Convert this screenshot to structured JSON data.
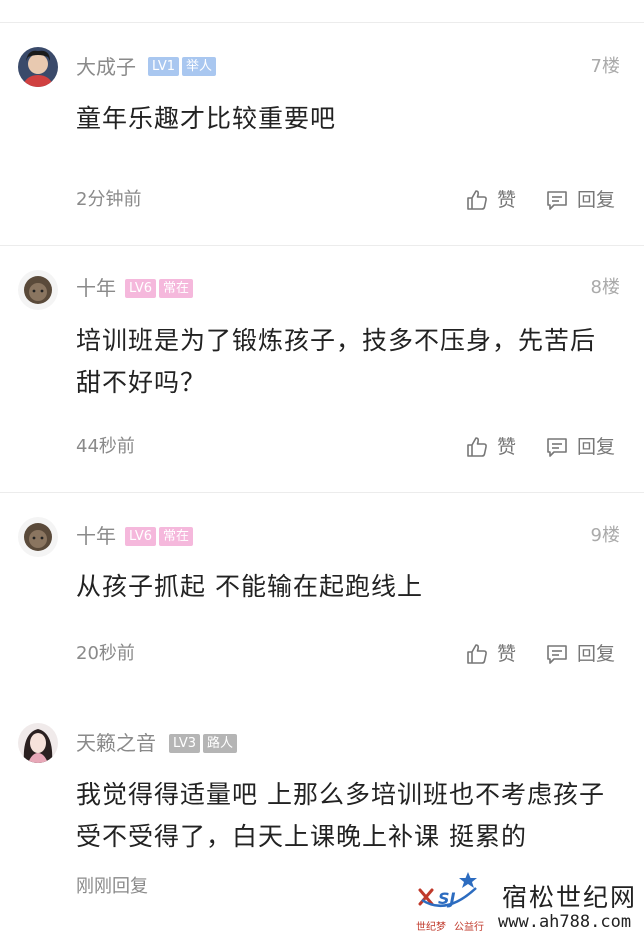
{
  "colors": {
    "lv1": "#a9c7f0",
    "lv6": "#f5b8dc",
    "lv3": "#b5b5b5",
    "tag_grey": "#b5b5b5"
  },
  "comments": [
    {
      "username": "大成子",
      "level": "LV1",
      "title": "举人",
      "floor": "7楼",
      "text": "童年乐趣才比较重要吧",
      "time": "2分钟前",
      "like_label": "赞",
      "reply_label": "回复",
      "avatar": "avatar-dark-hair"
    },
    {
      "username": "十年",
      "level": "LV6",
      "title": "常在",
      "floor": "8楼",
      "text": "培训班是为了锻炼孩子，技多不压身，先苦后甜不好吗？",
      "time": "44秒前",
      "like_label": "赞",
      "reply_label": "回复",
      "avatar": "avatar-buddha"
    },
    {
      "username": "十年",
      "level": "LV6",
      "title": "常在",
      "floor": "9楼",
      "text": "从孩子抓起 不能输在起跑线上",
      "time": "20秒前",
      "like_label": "赞",
      "reply_label": "回复",
      "avatar": "avatar-buddha"
    },
    {
      "username": "天籁之音",
      "level": "LV3",
      "title": "路人",
      "floor": "",
      "text": "我觉得得适量吧 上那么多培训班也不考虑孩子受不受得了，白天上课晚上补课 挺累的",
      "time": "刚刚回复",
      "avatar": "avatar-girl"
    }
  ],
  "watermark": {
    "title": "宿松世纪网",
    "url": "www.ah788.com",
    "logo_text": "SJ",
    "sub1": "世纪梦",
    "sub2": "公益行"
  }
}
